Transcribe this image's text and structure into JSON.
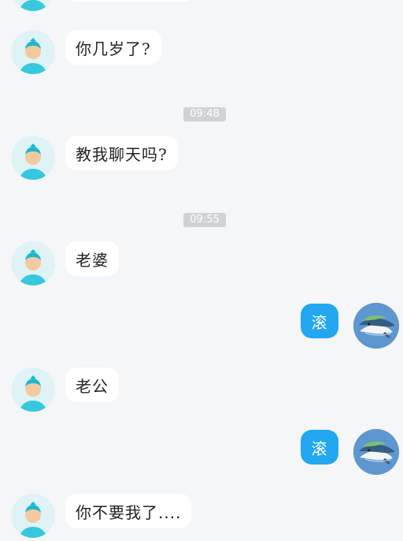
{
  "messages": [
    {
      "side": "left",
      "text": ""
    },
    {
      "side": "left",
      "text": "你几岁了?"
    },
    {
      "side": "left",
      "text": "教我聊天吗?"
    },
    {
      "side": "left",
      "text": "老婆"
    },
    {
      "side": "right",
      "text": "滚"
    },
    {
      "side": "left",
      "text": "老公"
    },
    {
      "side": "right",
      "text": "滚"
    },
    {
      "side": "left",
      "text": "你不要我了...."
    }
  ],
  "timestamps": [
    "09:48",
    "09:55"
  ],
  "icons": {
    "left_avatar": "user-avatar-icon",
    "right_avatar": "whale-avatar-icon"
  },
  "colors": {
    "background": "#f5f6f8",
    "incoming_bubble": "#ffffff",
    "outgoing_bubble": "#22a7f0",
    "timestamp_bg": "#cfd2d6"
  }
}
